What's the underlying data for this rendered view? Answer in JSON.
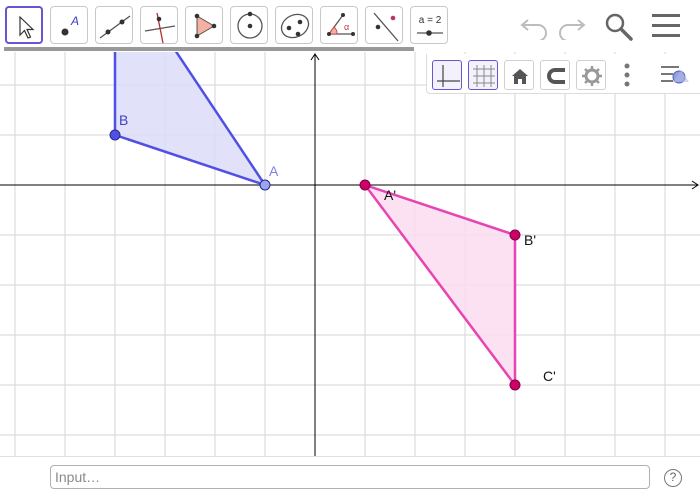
{
  "toolbar": {
    "tools": [
      {
        "name": "move-tool-button",
        "icon": "move-arrow-icon",
        "active": true
      },
      {
        "name": "point-tool-button",
        "icon": "point-icon",
        "label": "A"
      },
      {
        "name": "line-tool-button",
        "icon": "line-through-points-icon"
      },
      {
        "name": "perpendicular-line-tool-button",
        "icon": "perpendicular-line-icon"
      },
      {
        "name": "polygon-tool-button",
        "icon": "polygon-icon"
      },
      {
        "name": "circle-tool-button",
        "icon": "circle-center-point-icon"
      },
      {
        "name": "conic-tool-button",
        "icon": "ellipse-icon"
      },
      {
        "name": "angle-tool-button",
        "icon": "angle-icon"
      },
      {
        "name": "reflect-tool-button",
        "icon": "reflect-about-line-icon"
      },
      {
        "name": "slider-tool-button",
        "icon": "slider-icon",
        "label": "a = 2"
      }
    ],
    "undo_icon": "undo-icon",
    "redo_icon": "redo-icon",
    "search_icon": "search-icon",
    "menu_icon": "hamburger-menu-icon"
  },
  "style_bar": {
    "buttons": [
      {
        "name": "show-axes-button",
        "icon": "axes-icon",
        "active": true
      },
      {
        "name": "show-grid-button",
        "icon": "grid-icon",
        "active": true
      },
      {
        "name": "standard-view-button",
        "icon": "home-icon"
      },
      {
        "name": "point-capturing-button",
        "icon": "magnet-icon"
      },
      {
        "name": "graphics-settings-button",
        "icon": "gear-icon"
      },
      {
        "name": "more-options-button",
        "icon": "vertical-dots-icon"
      },
      {
        "name": "toggle-style-bar-button",
        "icon": "style-bar-toggle-icon"
      }
    ]
  },
  "graphics": {
    "grid_step": 1,
    "colors": {
      "original": "#5050e6",
      "original_fill": "#dcdcf8",
      "image": "#e646b4",
      "image_fill": "#fbdcf0",
      "image_point": "#cc0066",
      "grid": "#d6d6d6",
      "axis": "#000000"
    },
    "original_polygon": {
      "points": [
        {
          "label": "A",
          "x": -1,
          "y": 0
        },
        {
          "label": "B",
          "x": -4,
          "y": 1
        },
        {
          "label": "",
          "x": -4,
          "y": 3
        },
        {
          "label": "",
          "x": -3,
          "y": 3
        }
      ]
    },
    "image_polygon": {
      "points": [
        {
          "label": "A'",
          "x": 1,
          "y": 0
        },
        {
          "label": "B'",
          "x": 4,
          "y": -1
        },
        {
          "label": "C'",
          "x": 4,
          "y": -4
        }
      ]
    }
  },
  "input_bar": {
    "placeholder": "Input…",
    "help_label": "?"
  }
}
